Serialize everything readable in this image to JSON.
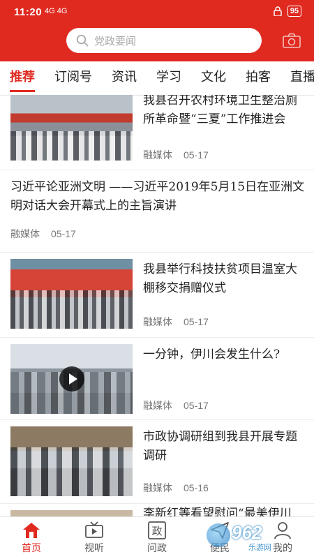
{
  "status_bar": {
    "time": "11:20",
    "signal": "4G 4G",
    "battery": "95"
  },
  "search": {
    "placeholder": "党政要闻"
  },
  "tabs": [
    "推荐",
    "订阅号",
    "资讯",
    "学习",
    "文化",
    "拍客",
    "直播"
  ],
  "active_tab": "推荐",
  "feed": [
    {
      "title": "我县召开农村环境卫生整治厕所革命暨“三夏”工作推进会",
      "source": "融媒体",
      "date": "05-17",
      "thumbnail": "meeting-photo"
    },
    {
      "title": "习近平论亚洲文明 ——习近平2019年5月15日在亚洲文明对话大会开幕式上的主旨演讲",
      "source": "融媒体",
      "date": "05-17",
      "thumbnail": null
    },
    {
      "title": "我县举行科技扶贫项目温室大棚移交捐赠仪式",
      "source": "融媒体",
      "date": "05-17",
      "thumbnail": "ceremony-photo"
    },
    {
      "title": "一分钟，伊川会发生什么?",
      "source": "融媒体",
      "date": "05-17",
      "thumbnail": "city-video"
    },
    {
      "title": "市政协调研组到我县开展专题调研",
      "source": "融媒体",
      "date": "05-16",
      "thumbnail": "visit-photo"
    },
    {
      "title": "李新红等看望慰问“最美伊川",
      "source": "",
      "date": "",
      "thumbnail": "partial-photo"
    }
  ],
  "bottom_nav": [
    {
      "label": "首页",
      "icon": "home-icon",
      "active": true
    },
    {
      "label": "视听",
      "icon": "tv-icon",
      "active": false
    },
    {
      "label": "问政",
      "icon": "politics-icon",
      "active": false
    },
    {
      "label": "便民",
      "icon": "send-icon",
      "active": false
    },
    {
      "label": "我的",
      "icon": "user-icon",
      "active": false
    }
  ],
  "watermark": {
    "text": "962",
    "subtext": "乐游网"
  },
  "colors": {
    "brand": "#e02a20",
    "text": "#222222",
    "meta": "#777777"
  }
}
